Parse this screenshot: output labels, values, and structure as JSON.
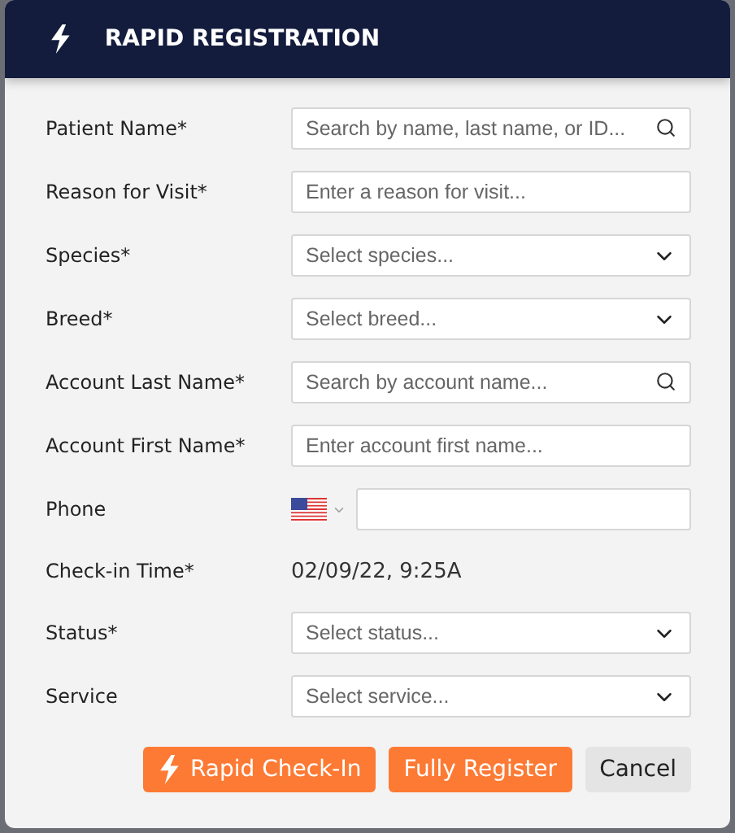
{
  "dialog": {
    "title": "RAPID REGISTRATION"
  },
  "fields": [
    {
      "label": "Patient Name*",
      "kind": "search",
      "placeholder": "Search by name, last name, or ID..."
    },
    {
      "label": "Reason for Visit*",
      "kind": "text",
      "placeholder": "Enter a reason for visit..."
    },
    {
      "label": "Species*",
      "kind": "select",
      "placeholder": "Select species..."
    },
    {
      "label": "Breed*",
      "kind": "select",
      "placeholder": "Select breed..."
    },
    {
      "label": "Account Last Name*",
      "kind": "search",
      "placeholder": "Search by account name..."
    },
    {
      "label": "Account First Name*",
      "kind": "text",
      "placeholder": "Enter account first name..."
    },
    {
      "label": "Phone",
      "kind": "phone"
    },
    {
      "label": "Check-in Time*",
      "kind": "static",
      "value": "02/09/22, 9:25A"
    },
    {
      "label": "Status*",
      "kind": "select",
      "placeholder": "Select status..."
    },
    {
      "label": "Service",
      "kind": "select",
      "placeholder": "Select service..."
    }
  ],
  "buttons": [
    {
      "label": "Rapid Check-In",
      "kind": "rapid"
    },
    {
      "label": "Fully Register",
      "kind": "primary"
    },
    {
      "label": "Cancel",
      "kind": "secondary"
    }
  ]
}
